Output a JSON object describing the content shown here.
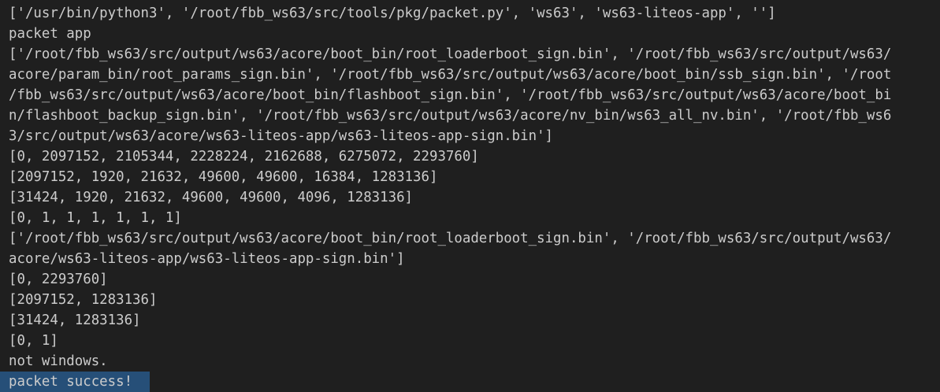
{
  "terminal": {
    "lines": [
      "['/usr/bin/python3', '/root/fbb_ws63/src/tools/pkg/packet.py', 'ws63', 'ws63-liteos-app', '']",
      "packet app",
      "['/root/fbb_ws63/src/output/ws63/acore/boot_bin/root_loaderboot_sign.bin', '/root/fbb_ws63/src/output/ws63/",
      "acore/param_bin/root_params_sign.bin', '/root/fbb_ws63/src/output/ws63/acore/boot_bin/ssb_sign.bin', '/root",
      "/fbb_ws63/src/output/ws63/acore/boot_bin/flashboot_sign.bin', '/root/fbb_ws63/src/output/ws63/acore/boot_bi",
      "n/flashboot_backup_sign.bin', '/root/fbb_ws63/src/output/ws63/acore/nv_bin/ws63_all_nv.bin', '/root/fbb_ws6",
      "3/src/output/ws63/acore/ws63-liteos-app/ws63-liteos-app-sign.bin']",
      "[0, 2097152, 2105344, 2228224, 2162688, 6275072, 2293760]",
      "[2097152, 1920, 21632, 49600, 49600, 16384, 1283136]",
      "[31424, 1920, 21632, 49600, 49600, 4096, 1283136]",
      "[0, 1, 1, 1, 1, 1, 1]",
      "['/root/fbb_ws63/src/output/ws63/acore/boot_bin/root_loaderboot_sign.bin', '/root/fbb_ws63/src/output/ws63/",
      "acore/ws63-liteos-app/ws63-liteos-app-sign.bin']",
      "[0, 2293760]",
      "[2097152, 1283136]",
      "[31424, 1283136]",
      "[0, 1]",
      "not windows.",
      "packet success!"
    ],
    "colors": {
      "background": "#1f1f1f",
      "foreground": "#cccccc",
      "selection": "#264f78"
    }
  }
}
